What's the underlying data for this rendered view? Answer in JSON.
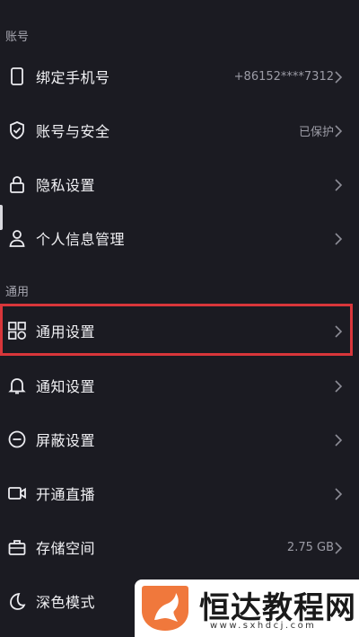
{
  "sections": {
    "account": "账号",
    "general": "通用"
  },
  "rows": {
    "bind_phone": {
      "label": "绑定手机号",
      "value": "+86152****7312"
    },
    "account_security": {
      "label": "账号与安全",
      "value": "已保护"
    },
    "privacy": {
      "label": "隐私设置"
    },
    "personal_info": {
      "label": "个人信息管理"
    },
    "general_settings": {
      "label": "通用设置"
    },
    "notifications": {
      "label": "通知设置"
    },
    "block_settings": {
      "label": "屏蔽设置"
    },
    "live_stream": {
      "label": "开通直播"
    },
    "storage": {
      "label": "存储空间",
      "value": "2.75 GB"
    },
    "dark_mode": {
      "label": "深色模式"
    }
  },
  "watermark": {
    "brand": "恒达教程网",
    "url": "www.sxhdcj.com"
  },
  "colors": {
    "background": "#1b1b22",
    "highlight_border": "#d8363a",
    "logo_orange": "#f0783c"
  }
}
